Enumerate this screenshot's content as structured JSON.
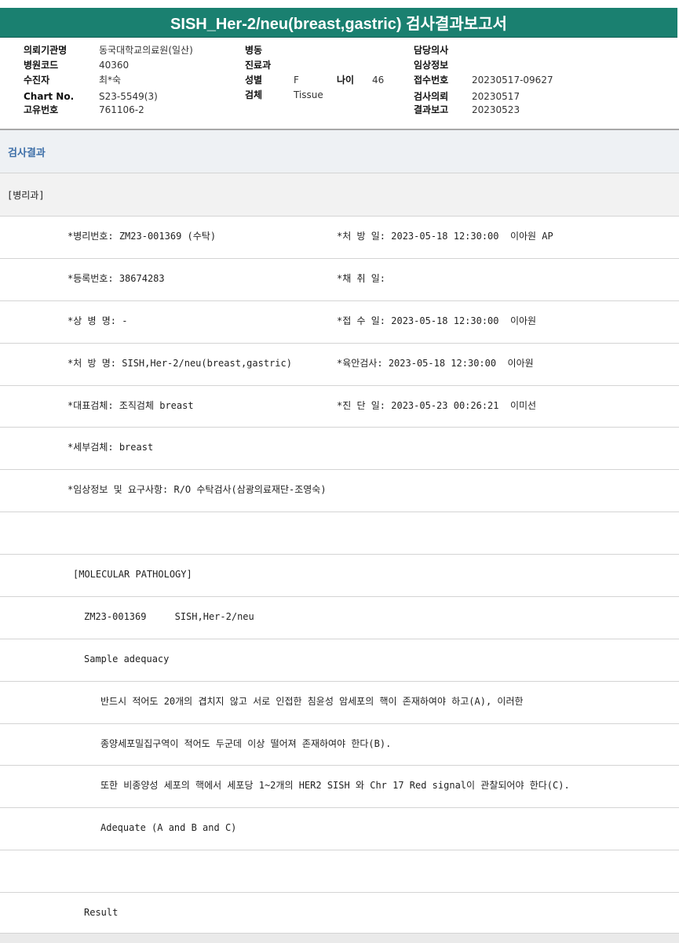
{
  "report": {
    "title": "SISH_Her-2/neu(breast,gastric) 검사결과보고서"
  },
  "header": {
    "col1": [
      {
        "label": "의뢰기관명",
        "value": "동국대학교의료원(일산)"
      },
      {
        "label": "병원코드",
        "value": "40360"
      },
      {
        "label": "수진자",
        "value": "최*숙"
      },
      {
        "label": "Chart No.",
        "value": "S23-5549(3)"
      },
      {
        "label": "고유번호",
        "value": "761106-2"
      }
    ],
    "col2": [
      {
        "label": "병동",
        "value": ""
      },
      {
        "label": "진료과",
        "value": ""
      },
      {
        "label": "성별",
        "value": "F"
      },
      {
        "label": "검체",
        "value": "Tissue"
      }
    ],
    "age_label": "나이",
    "age_value": "46",
    "col3": [
      {
        "label": "담당의사",
        "value": ""
      },
      {
        "label": "임상정보",
        "value": ""
      },
      {
        "label": "접수번호",
        "value": "20230517-09627"
      },
      {
        "label": "검사의뢰",
        "value": "20230517"
      },
      {
        "label": "결과보고",
        "value": "20230523"
      }
    ]
  },
  "section": {
    "title": "검사결과",
    "department": "[병리과]"
  },
  "fields": {
    "pathology_no": "*병리번호: ZM23-001369 (수탁)",
    "order_date": "*처 방 일: 2023-05-18 12:30:00  이아원 AP",
    "registration_no": "*등록번호: 38674283",
    "collection_date": "*채 취 일:",
    "disease_name": "*상 병 명: -",
    "receipt_date": "*접 수 일: 2023-05-18 12:30:00  이아원",
    "order_name": "*처 방 명: SISH,Her-2/neu(breast,gastric)",
    "gross_exam": "*육안검사: 2023-05-18 12:30:00  이아원",
    "rep_specimen": "*대표검체: 조직검체 breast",
    "diagnosis_date": "*진 단 일: 2023-05-23 00:26:21  이미선",
    "detail_specimen": "*세부검체: breast",
    "clinical_info": "*임상정보 및 요구사항: R/O 수탁검사(삼광의료재단-조영숙)"
  },
  "body": {
    "molecular_header": "[MOLECULAR PATHOLOGY]",
    "case_line": "ZM23-001369     SISH,Her-2/neu",
    "sample_adequacy": "Sample adequacy",
    "adequacy_line1": "반드시 적어도 20개의 겹치지 않고 서로 인접한 침윤성 암세포의 핵이 존재하여야 하고(A), 이러한",
    "adequacy_line2": "종양세포밀집구역이 적어도 두군데 이상 떨어져 존재하여야 한다(B).",
    "adequacy_line3": "또한 비종양성 세포의 핵에서 세포당 1~2개의 HER2 SISH 와 Chr 17 Red signal이 관찰되어야 한다(C).",
    "adequacy_result": "Adequate (A and B and C)",
    "result_label": "Result"
  },
  "colors": {
    "title_bar": "#1a8070",
    "section_title": "#3d6fa8"
  }
}
